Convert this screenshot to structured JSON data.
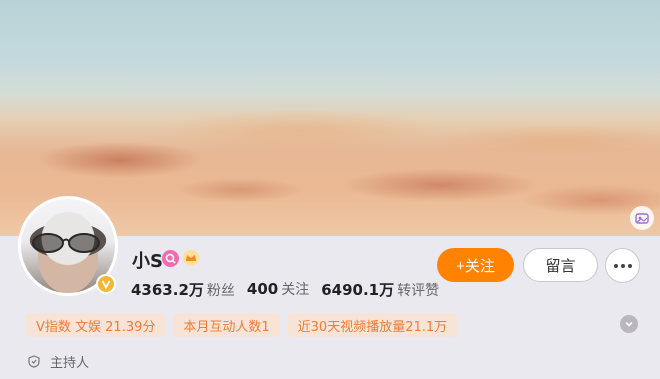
{
  "profile": {
    "name": "小S",
    "stats": {
      "fans_value": "4363.2万",
      "fans_label": "粉丝",
      "following_value": "400",
      "following_label": "关注",
      "reposts_value": "6490.1万",
      "reposts_label": "转评赞"
    },
    "actions": {
      "follow_label": "+关注",
      "message_label": "留言"
    },
    "tags": [
      "V指数 文娱 21.39分",
      "本月互动人数1",
      "近30天视频播放量21.1万"
    ],
    "role": "主持人"
  },
  "colors": {
    "accent": "#ff8200",
    "tag_text": "#ee7d36",
    "tag_bg": "#f7e4d7",
    "pink_badge": "#f06bb1"
  },
  "icons": [
    "cover-edit-icon",
    "verified-v-icon",
    "pink-badge-icon",
    "crown-icon",
    "more-icon",
    "expand-chevron-icon",
    "shield-icon"
  ]
}
